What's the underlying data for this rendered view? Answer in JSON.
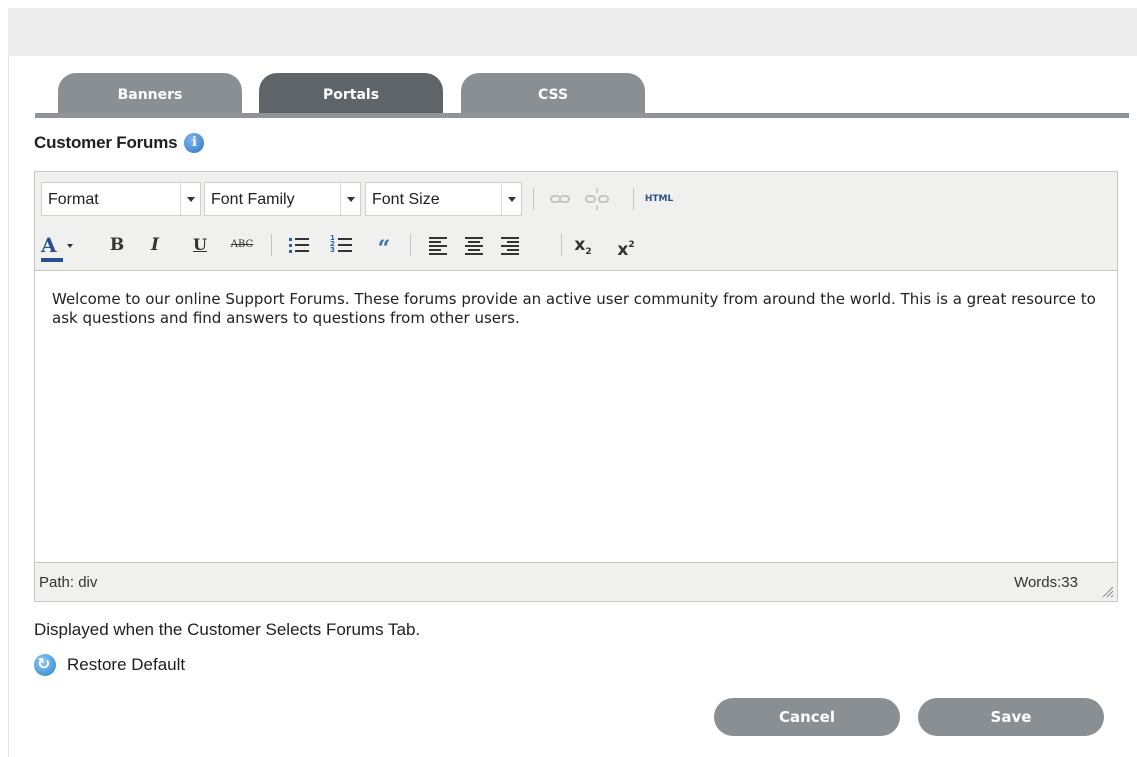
{
  "tabs": [
    {
      "label": "Banners",
      "active": false
    },
    {
      "label": "Portals",
      "active": true
    },
    {
      "label": "CSS",
      "active": false
    }
  ],
  "section": {
    "title": "Customer Forums",
    "info_icon": "info-icon"
  },
  "toolbar": {
    "format": {
      "selected": "Format"
    },
    "font_family": {
      "selected": "Font Family"
    },
    "font_size": {
      "selected": "Font Size"
    },
    "link_icon": "link-icon",
    "unlink_icon": "unlink-icon",
    "html_label": "HTML",
    "font_color_label": "A",
    "bold_label": "B",
    "italic_label": "I",
    "underline_label": "U",
    "strike_label": "ABC",
    "quote_label": "“",
    "subscript_label": "x",
    "subscript_mark": "2",
    "superscript_label": "x",
    "superscript_mark": "2"
  },
  "editor": {
    "content": "Welcome to our online Support Forums. These forums provide an active user community from around the world. This is a great resource to ask questions and find answers to questions from other users.",
    "path": "Path: div",
    "word_count": "Words:33"
  },
  "helper_text": "Displayed when the Customer Selects Forums Tab.",
  "restore_default_label": "Restore Default",
  "buttons": {
    "cancel": "Cancel",
    "save": "Save"
  },
  "colors": {
    "tab_active": "#5e6468",
    "tab_inactive": "#8a8f93",
    "button": "#8a8f93",
    "toolbar_bg": "#f0f0ee",
    "accent_blue": "#2a4f8f"
  }
}
